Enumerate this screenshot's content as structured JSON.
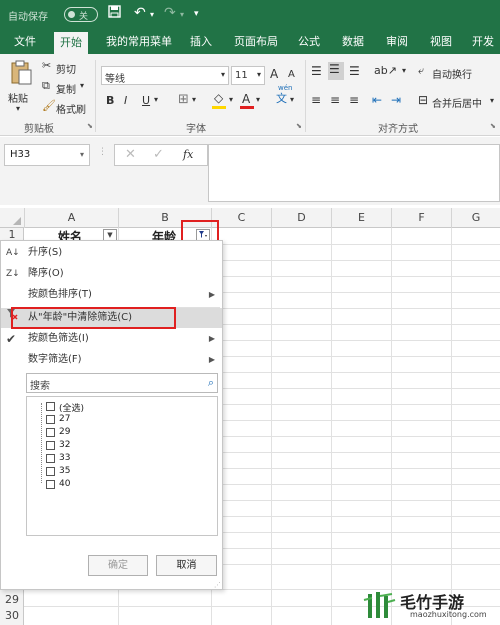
{
  "title_bar": {
    "autosave_label": "自动保存",
    "autosave_state": "关",
    "qa_customize": "▾"
  },
  "tabs": [
    "文件",
    "开始",
    "我的常用菜单",
    "插入",
    "页面布局",
    "公式",
    "数据",
    "审阅",
    "视图",
    "开发工"
  ],
  "active_tab": "开始",
  "ribbon": {
    "clipboard": {
      "paste": "粘贴",
      "cut": "剪切",
      "copy": "复制",
      "format_painter": "格式刷",
      "group": "剪贴板"
    },
    "font": {
      "name": "等线",
      "size": "11",
      "bold": "B",
      "italic": "I",
      "underline": "U",
      "font_color": "A",
      "grow": "A",
      "shrink": "A",
      "wen": "文",
      "group": "字体"
    },
    "alignment": {
      "wrap": "自动换行",
      "merge": "合并后居中",
      "group": "对齐方式"
    }
  },
  "formula_bar": {
    "name_box": "H33",
    "fx": "fx"
  },
  "columns": [
    "A",
    "B",
    "C",
    "D",
    "E",
    "F",
    "G"
  ],
  "rows_visible": [
    "1",
    "29",
    "30"
  ],
  "cells": {
    "A1": "姓名",
    "B1": "年龄"
  },
  "filter_menu": {
    "items": [
      {
        "label": "升序(S)",
        "icon": "sort-asc-icon"
      },
      {
        "label": "降序(O)",
        "icon": "sort-desc-icon"
      },
      {
        "label": "按颜色排序(T)",
        "submenu": true
      },
      {
        "label": "从\"年龄\"中清除筛选(C)",
        "icon": "clear-filter-icon",
        "highlight": true
      },
      {
        "label": "按颜色筛选(I)",
        "submenu": true,
        "checked": true
      },
      {
        "label": "数字筛选(F)",
        "submenu": true
      }
    ],
    "search_placeholder": "搜索",
    "list": [
      "(全选)",
      "27",
      "29",
      "32",
      "33",
      "35",
      "40"
    ],
    "ok": "确定",
    "cancel": "取消"
  },
  "watermark": {
    "name": "毛竹手游",
    "url": "maozhuxitong.com"
  },
  "colors": {
    "brand": "#217346",
    "highlight_border": "#e02020"
  }
}
